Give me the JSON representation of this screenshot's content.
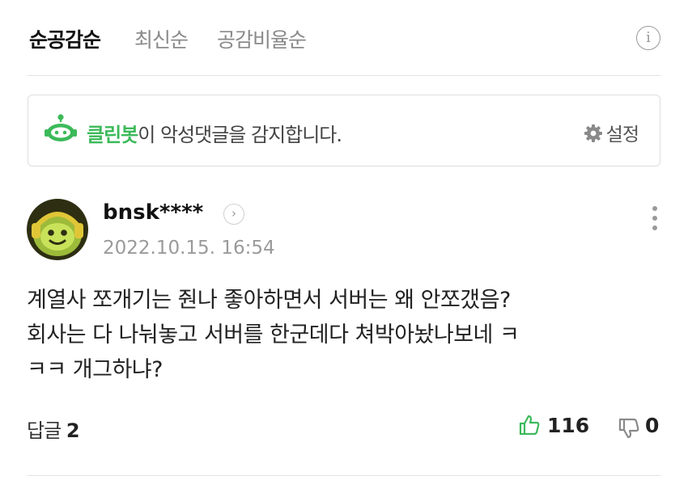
{
  "sort": {
    "options": [
      "순공감순",
      "최신순",
      "공감비율순"
    ],
    "active": "순공감순"
  },
  "cleanbot": {
    "brand": "클린봇",
    "message": "이 악성댓글을 감지합니다.",
    "settings_label": "설정"
  },
  "comment": {
    "username": "bnsk****",
    "timestamp": "2022.10.15. 16:54",
    "lines": [
      "계열사 쪼개기는 줜나 좋아하면서 서버는 왜 안쪼갰음?",
      "회사는 다 나눠놓고 서버를 한군데다 쳐박아놨나보네 ㅋ",
      "ㅋㅋ 개그하냐?"
    ],
    "replies_label": "답글",
    "replies_count": "2",
    "likes": "116",
    "dislikes": "0"
  },
  "colors": {
    "cleanbot_green": "#3cba5a",
    "inactive_text": "#8a8a8a",
    "divider": "#e3e3e3"
  },
  "icons": {
    "info": "info-icon",
    "bot": "cleanbot-robot-icon",
    "settings": "gear-icon",
    "profile": "chevron-right-icon",
    "more": "more-vertical-icon",
    "like": "thumbs-up-icon",
    "dislike": "thumbs-down-icon"
  }
}
